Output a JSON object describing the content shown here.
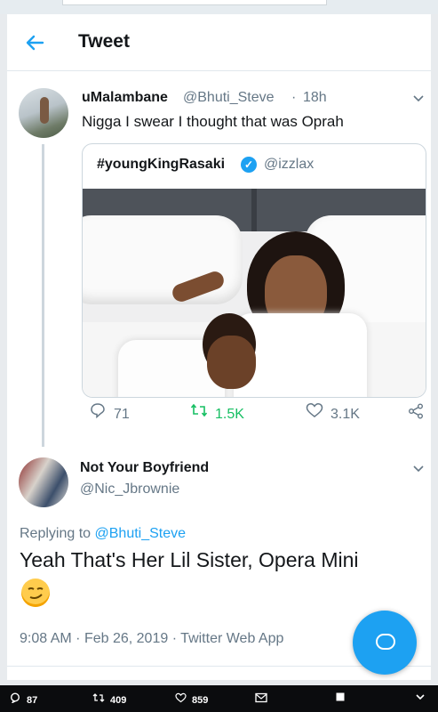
{
  "header": {
    "title": "Tweet"
  },
  "tweet": {
    "display_name": "uMalambane",
    "handle": "@Bhuti_Steve",
    "separator": "·",
    "time": "18h",
    "text": "Nigga I swear I thought that was Oprah",
    "quoted": {
      "display_name": "#youngKingRasaki",
      "handle": "@izzlax"
    },
    "actions": {
      "replies": "71",
      "retweets": "1.5K",
      "likes": "3.1K"
    }
  },
  "reply": {
    "display_name": "Not Your Boyfriend",
    "handle": "@Nic_Jbrownie",
    "replying_prefix": "Replying to",
    "replying_to": "@Bhuti_Steve",
    "text": "Yeah That's Her Lil Sister, Opera Mini",
    "emoji": "smirking-face",
    "time": "9:08 AM",
    "date": "Feb 26, 2019",
    "source": "Twitter Web App",
    "meta_separator": "·"
  },
  "taskbar": {
    "replies": "87",
    "retweets": "409",
    "likes": "859"
  },
  "colors": {
    "accent": "#1da1f2",
    "retweet_green": "#17bf63",
    "secondary_text": "#657786"
  }
}
